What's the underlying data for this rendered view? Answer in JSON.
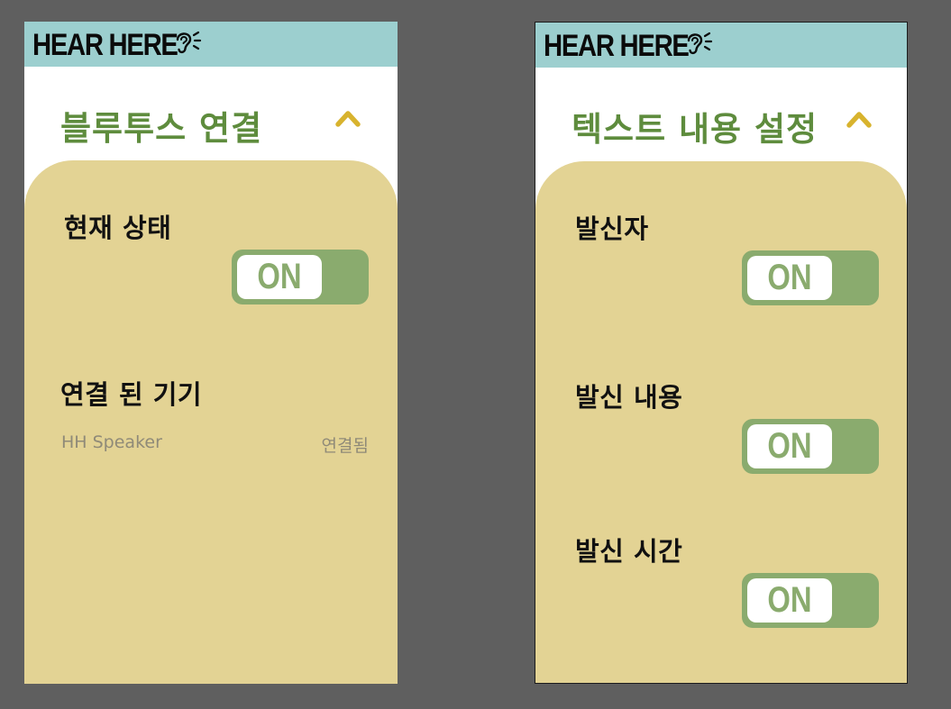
{
  "colors": {
    "background": "#5f5f5f",
    "header": "#9ccfcf",
    "title_green": "#5e8c3d",
    "chevron_yellow": "#d8b32e",
    "panel": "#e3d394",
    "toggle_green": "#8aab6e"
  },
  "left_screen": {
    "logo_text": "HEAR HERE",
    "logo_icon": "ear-icon",
    "section_title": "블루투스 연결",
    "chevron_icon": "chevron-up-icon",
    "current_status": {
      "label": "현재 상태",
      "toggle_label": "ON",
      "state": "on"
    },
    "connected_devices": {
      "label": "연결 된 기기",
      "devices": [
        {
          "name": "HH Speaker",
          "status": "연결됨"
        }
      ]
    }
  },
  "right_screen": {
    "logo_text": "HEAR HERE",
    "logo_icon": "ear-icon",
    "section_title": "텍스트 내용 설정",
    "chevron_icon": "chevron-up-icon",
    "settings": [
      {
        "label": "발신자",
        "toggle_label": "ON",
        "state": "on"
      },
      {
        "label": "발신 내용",
        "toggle_label": "ON",
        "state": "on"
      },
      {
        "label": "발신 시간",
        "toggle_label": "ON",
        "state": "on"
      }
    ]
  }
}
